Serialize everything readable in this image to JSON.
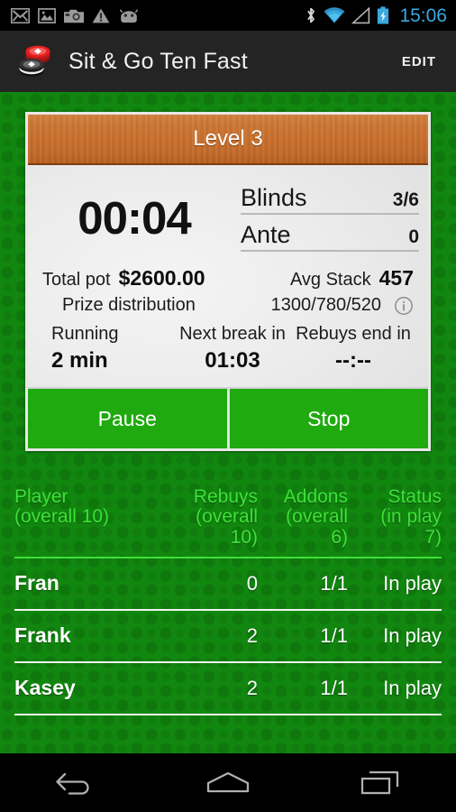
{
  "status_bar": {
    "time": "15:06",
    "left_icons": [
      "gmail-icon",
      "gallery-icon",
      "camera-icon",
      "warning-icon",
      "android-icon"
    ],
    "right_icons": [
      "bluetooth-icon",
      "wifi-icon",
      "signal-icon",
      "battery-charging-icon"
    ],
    "accent_color": "#3aa9de"
  },
  "action_bar": {
    "app_icon": "poker-chips-icon",
    "title": "Sit & Go Ten Fast",
    "edit_label": "EDIT"
  },
  "timer_card": {
    "level_label": "Level 3",
    "time_remaining": "00:04",
    "blinds_label": "Blinds",
    "blinds_value": "3/6",
    "ante_label": "Ante",
    "ante_value": "0",
    "total_pot_label": "Total pot",
    "total_pot_value": "$2600.00",
    "avg_stack_label": "Avg Stack",
    "avg_stack_value": "457",
    "prize_distribution_label": "Prize distribution",
    "prize_distribution_value": "1300/780/520",
    "info_icon": "info-icon",
    "running_label": "Running",
    "running_value": "2 min",
    "next_break_label": "Next break in",
    "next_break_value": "01:03",
    "rebuys_end_label": "Rebuys end in",
    "rebuys_end_value": "--:--",
    "pause_label": "Pause",
    "stop_label": "Stop",
    "header_color": "#c96f2c",
    "button_color": "#1faa10"
  },
  "players_table": {
    "headers": {
      "player": "Player\n(overall 10)",
      "player_line1": "Player",
      "player_line2": "(overall 10)",
      "rebuys_line1": "Rebuys",
      "rebuys_line2": "(overall",
      "rebuys_line3": "10)",
      "addons_line1": "Addons",
      "addons_line2": "(overall",
      "addons_line3": "6)",
      "status_line1": "Status",
      "status_line2": "(in play",
      "status_line3": "7)"
    },
    "rows": [
      {
        "player": "Fran",
        "rebuys": "0",
        "addons": "1/1",
        "status": "In play"
      },
      {
        "player": "Frank",
        "rebuys": "2",
        "addons": "1/1",
        "status": "In play"
      },
      {
        "player": "Kasey",
        "rebuys": "2",
        "addons": "1/1",
        "status": "In play"
      }
    ],
    "header_color": "#3fe03a",
    "felt_color": "#11870f"
  },
  "nav_bar": {
    "back": "back-icon",
    "home": "home-icon",
    "recents": "recents-icon"
  }
}
